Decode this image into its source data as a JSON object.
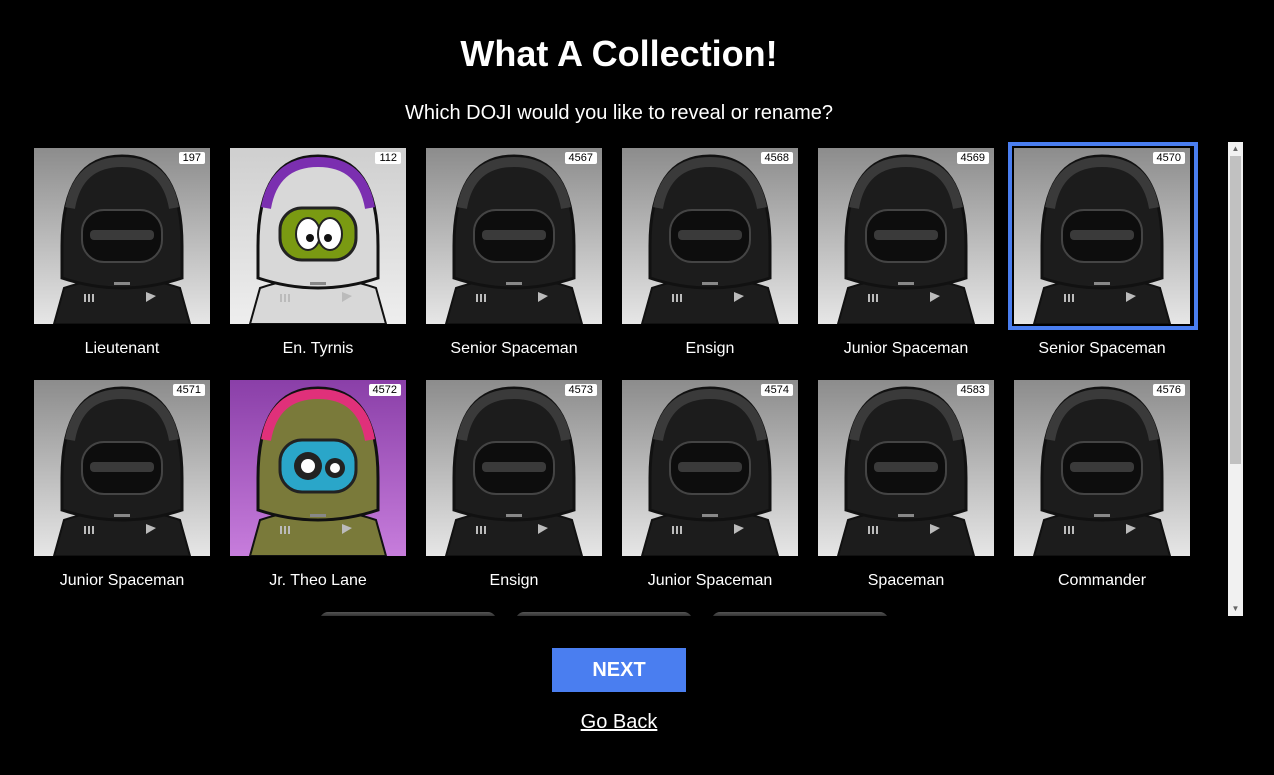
{
  "header": {
    "title": "What A Collection!",
    "subtitle": "Which DOJI would you like to reveal or rename?"
  },
  "collection": [
    {
      "id": "197",
      "name": "Lieutenant",
      "variant": "default",
      "selected": false
    },
    {
      "id": "112",
      "name": "En. Tyrnis",
      "variant": "green",
      "selected": false
    },
    {
      "id": "4567",
      "name": "Senior Spaceman",
      "variant": "default",
      "selected": false
    },
    {
      "id": "4568",
      "name": "Ensign",
      "variant": "default",
      "selected": false
    },
    {
      "id": "4569",
      "name": "Junior Spaceman",
      "variant": "default",
      "selected": false
    },
    {
      "id": "4570",
      "name": "Senior Spaceman",
      "variant": "default",
      "selected": true
    },
    {
      "id": "4571",
      "name": "Junior Spaceman",
      "variant": "default",
      "selected": false
    },
    {
      "id": "4572",
      "name": "Jr. Theo Lane",
      "variant": "gears",
      "selected": false
    },
    {
      "id": "4573",
      "name": "Ensign",
      "variant": "default",
      "selected": false
    },
    {
      "id": "4574",
      "name": "Junior Spaceman",
      "variant": "default",
      "selected": false
    },
    {
      "id": "4583",
      "name": "Spaceman",
      "variant": "default",
      "selected": false
    },
    {
      "id": "4576",
      "name": "Commander",
      "variant": "default",
      "selected": false
    }
  ],
  "colors": {
    "accent": "#4a7ef0",
    "background": "#000000"
  },
  "actions": {
    "next_label": "NEXT",
    "back_label": "Go Back"
  }
}
